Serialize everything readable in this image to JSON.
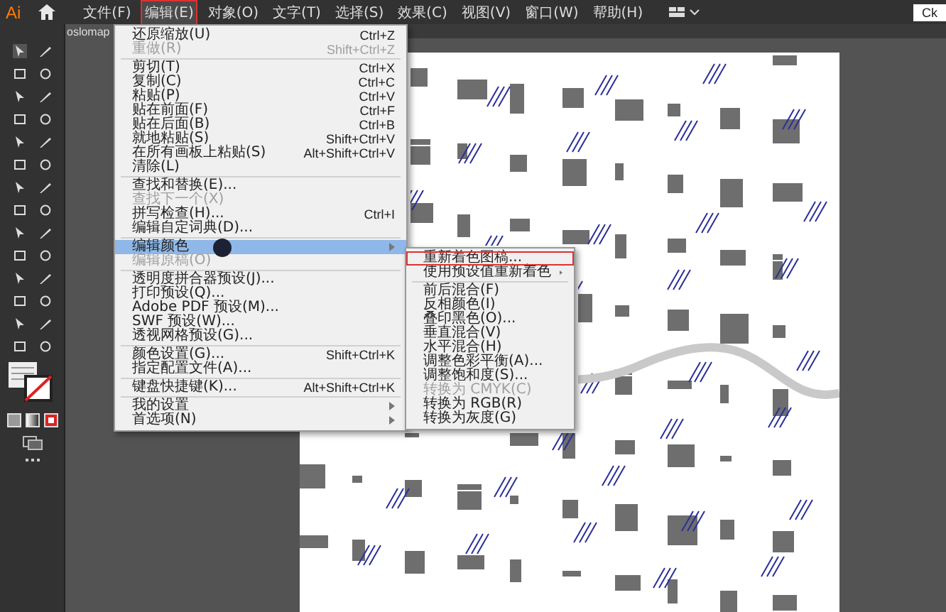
{
  "app": {
    "logo": "Ai"
  },
  "menubar": [
    {
      "label": "文件(F)",
      "selected": false
    },
    {
      "label": "编辑(E)",
      "selected": true
    },
    {
      "label": "对象(O)",
      "selected": false
    },
    {
      "label": "文字(T)",
      "selected": false
    },
    {
      "label": "选择(S)",
      "selected": false
    },
    {
      "label": "效果(C)",
      "selected": false
    },
    {
      "label": "视图(V)",
      "selected": false
    },
    {
      "label": "窗口(W)",
      "selected": false
    },
    {
      "label": "帮助(H)",
      "selected": false
    }
  ],
  "right_button": "Ck",
  "document_tab": "oslomap",
  "edit_menu": {
    "items": [
      {
        "kind": "item",
        "label": "还原缩放(U)",
        "shortcut": "Ctrl+Z",
        "disabled": false,
        "selected": false,
        "submenu": false
      },
      {
        "kind": "item",
        "label": "重做(R)",
        "shortcut": "Shift+Ctrl+Z",
        "disabled": true,
        "selected": false,
        "submenu": false
      },
      {
        "kind": "separator"
      },
      {
        "kind": "item",
        "label": "剪切(T)",
        "shortcut": "Ctrl+X",
        "disabled": false,
        "selected": false,
        "submenu": false
      },
      {
        "kind": "item",
        "label": "复制(C)",
        "shortcut": "Ctrl+C",
        "disabled": false,
        "selected": false,
        "submenu": false
      },
      {
        "kind": "item",
        "label": "粘贴(P)",
        "shortcut": "Ctrl+V",
        "disabled": false,
        "selected": false,
        "submenu": false
      },
      {
        "kind": "item",
        "label": "贴在前面(F)",
        "shortcut": "Ctrl+F",
        "disabled": false,
        "selected": false,
        "submenu": false
      },
      {
        "kind": "item",
        "label": "贴在后面(B)",
        "shortcut": "Ctrl+B",
        "disabled": false,
        "selected": false,
        "submenu": false
      },
      {
        "kind": "item",
        "label": "就地粘贴(S)",
        "shortcut": "Shift+Ctrl+V",
        "disabled": false,
        "selected": false,
        "submenu": false
      },
      {
        "kind": "item",
        "label": "在所有画板上粘贴(S)",
        "shortcut": "Alt+Shift+Ctrl+V",
        "disabled": false,
        "selected": false,
        "submenu": false
      },
      {
        "kind": "item",
        "label": "清除(L)",
        "disabled": false,
        "selected": false,
        "submenu": false
      },
      {
        "kind": "separator"
      },
      {
        "kind": "item",
        "label": "查找和替换(E)...",
        "disabled": false,
        "selected": false,
        "submenu": false
      },
      {
        "kind": "item",
        "label": "查找下一个(X)",
        "disabled": true,
        "selected": false,
        "submenu": false
      },
      {
        "kind": "item",
        "label": "拼写检查(H)...",
        "shortcut": "Ctrl+I",
        "disabled": false,
        "selected": false,
        "submenu": false
      },
      {
        "kind": "item",
        "label": "编辑自定词典(D)...",
        "disabled": false,
        "selected": false,
        "submenu": false
      },
      {
        "kind": "separator"
      },
      {
        "kind": "item",
        "label": "编辑颜色",
        "disabled": false,
        "selected": true,
        "submenu": true
      },
      {
        "kind": "item",
        "label": "编辑原稿(O)",
        "disabled": true,
        "selected": false,
        "submenu": false
      },
      {
        "kind": "separator"
      },
      {
        "kind": "item",
        "label": "透明度拼合器预设(J)...",
        "disabled": false,
        "selected": false,
        "submenu": false
      },
      {
        "kind": "item",
        "label": "打印预设(Q)...",
        "disabled": false,
        "selected": false,
        "submenu": false
      },
      {
        "kind": "item",
        "label": "Adobe PDF 预设(M)...",
        "disabled": false,
        "selected": false,
        "submenu": false
      },
      {
        "kind": "item",
        "label": "SWF 预设(W)...",
        "disabled": false,
        "selected": false,
        "submenu": false
      },
      {
        "kind": "item",
        "label": "透视网格预设(G)...",
        "disabled": false,
        "selected": false,
        "submenu": false
      },
      {
        "kind": "separator"
      },
      {
        "kind": "item",
        "label": "颜色设置(G)...",
        "shortcut": "Shift+Ctrl+K",
        "disabled": false,
        "selected": false,
        "submenu": false
      },
      {
        "kind": "item",
        "label": "指定配置文件(A)...",
        "disabled": false,
        "selected": false,
        "submenu": false
      },
      {
        "kind": "separator"
      },
      {
        "kind": "item",
        "label": "键盘快捷键(K)...",
        "shortcut": "Alt+Shift+Ctrl+K",
        "disabled": false,
        "selected": false,
        "submenu": false
      },
      {
        "kind": "separator"
      },
      {
        "kind": "item",
        "label": "我的设置",
        "disabled": false,
        "selected": false,
        "submenu": true
      },
      {
        "kind": "item",
        "label": "首选项(N)",
        "disabled": false,
        "selected": false,
        "submenu": true
      }
    ]
  },
  "color_submenu": {
    "items": [
      {
        "kind": "item",
        "label": "重新着色图稿...",
        "disabled": false,
        "selected": true,
        "submenu": false
      },
      {
        "kind": "item",
        "label": "使用预设值重新着色",
        "disabled": false,
        "selected": false,
        "submenu": true
      },
      {
        "kind": "separator"
      },
      {
        "kind": "item",
        "label": "前后混合(F)",
        "disabled": false,
        "selected": false,
        "submenu": false
      },
      {
        "kind": "item",
        "label": "反相颜色(I)",
        "disabled": false,
        "selected": false,
        "submenu": false
      },
      {
        "kind": "item",
        "label": "叠印黑色(O)...",
        "disabled": false,
        "selected": false,
        "submenu": false
      },
      {
        "kind": "item",
        "label": "垂直混合(V)",
        "disabled": false,
        "selected": false,
        "submenu": false
      },
      {
        "kind": "item",
        "label": "水平混合(H)",
        "disabled": false,
        "selected": false,
        "submenu": false
      },
      {
        "kind": "item",
        "label": "调整色彩平衡(A)...",
        "disabled": false,
        "selected": false,
        "submenu": false
      },
      {
        "kind": "item",
        "label": "调整饱和度(S)...",
        "disabled": false,
        "selected": false,
        "submenu": false
      },
      {
        "kind": "item",
        "label": "转换为 CMYK(C)",
        "disabled": true,
        "selected": false,
        "submenu": false
      },
      {
        "kind": "item",
        "label": "转换为 RGB(R)",
        "disabled": false,
        "selected": false,
        "submenu": false
      },
      {
        "kind": "item",
        "label": "转换为灰度(G)",
        "disabled": false,
        "selected": false,
        "submenu": false
      }
    ]
  }
}
